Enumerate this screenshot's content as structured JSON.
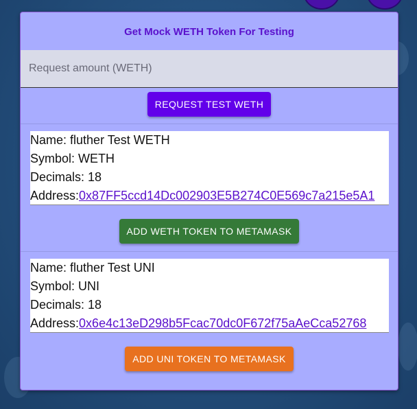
{
  "faucet": {
    "title": "Get Mock WETH Token For Testing",
    "amount_placeholder": "Request amount (WETH)",
    "request_button": "REQUEST TEST WETH"
  },
  "tokens": [
    {
      "name_label": "Name: ",
      "name": "fluther Test WETH",
      "symbol_label": "Symbol: ",
      "symbol": "WETH",
      "decimals_label": "Decimals: ",
      "decimals": "18",
      "address_label": "Address:",
      "address": "0x87FF5ccd14Dc002903E5B274C0E569c7a215e5A1",
      "add_button": "ADD WETH TOKEN TO METAMASK",
      "button_color": "#357a38"
    },
    {
      "name_label": "Name: ",
      "name": "fluther Test UNI",
      "symbol_label": "Symbol: ",
      "symbol": "UNI",
      "decimals_label": "Decimals: ",
      "decimals": "18",
      "address_label": "Address:",
      "address": "0x6e4c13eD298b5Fcac70dc0F672f75aAeCca52768",
      "add_button": "ADD UNI TOKEN TO METAMASK",
      "button_color": "#e8711f"
    }
  ],
  "colors": {
    "panel_background": "#a8acff",
    "title_color": "#5a10cc",
    "request_button": "#6200ea",
    "link_color": "#5a10cc"
  }
}
